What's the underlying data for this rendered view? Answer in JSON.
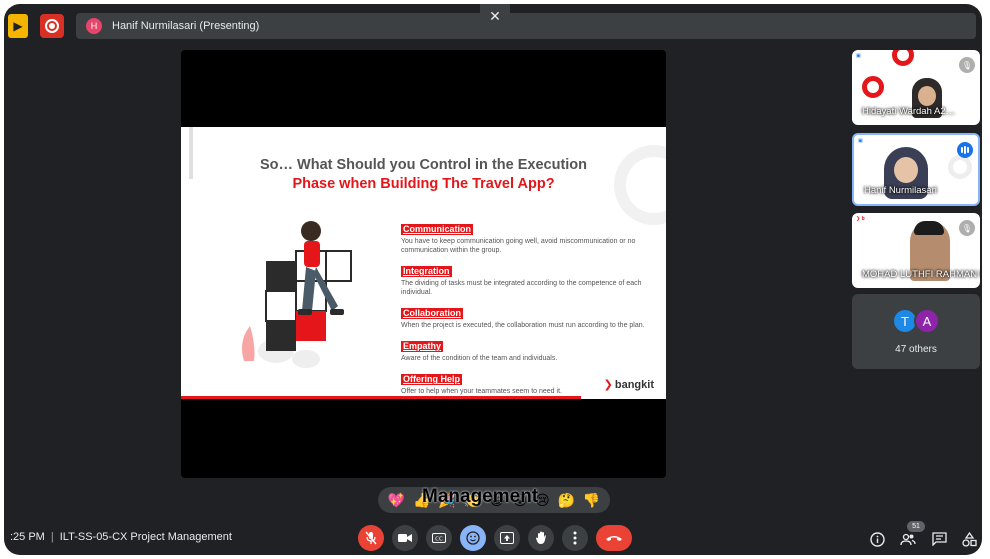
{
  "topbar": {
    "presenter_initial": "H",
    "presenter_label": "Hanif Nurmilasari (Presenting)"
  },
  "slide": {
    "title_line1": "So… What Should you Control in the Execution",
    "title_line2": "Phase when Building The Travel App?",
    "items": [
      {
        "heading": "Communication",
        "text": "You have to keep communication going well, avoid miscommunication or no communication within the group."
      },
      {
        "heading": "Integration",
        "text": "The dividing of tasks must be integrated according to the competence of each individual."
      },
      {
        "heading": "Collaboration",
        "text": "When the project is executed, the collaboration must run according to the plan."
      },
      {
        "heading": "Empathy",
        "text": "Aware of the condition of the team and individuals."
      },
      {
        "heading": "Offering Help",
        "text": "Offer to help when your teammates seem to need it."
      }
    ],
    "logo_text": "bangkit"
  },
  "participants": [
    {
      "name": "Hidayati Wardah A2…",
      "mic": "muted"
    },
    {
      "name": "Hanif Nurmilasari",
      "mic": "speaking"
    },
    {
      "name": "MOHAD LUTHFI RAHMAN D…",
      "mic": "muted"
    }
  ],
  "others": {
    "avatars": [
      {
        "initial": "T",
        "color": "#1e88e5"
      },
      {
        "initial": "A",
        "color": "#8e24aa"
      }
    ],
    "label": "47 others"
  },
  "reactions": [
    "💖",
    "👍",
    "🎉",
    "👏",
    "😂",
    "😮",
    "😢",
    "🤔",
    "👎"
  ],
  "caption_text": "Management",
  "bottombar": {
    "time": ":25 PM",
    "meeting_name": "ILT-SS-05-CX Project Management",
    "participant_count": "51"
  }
}
